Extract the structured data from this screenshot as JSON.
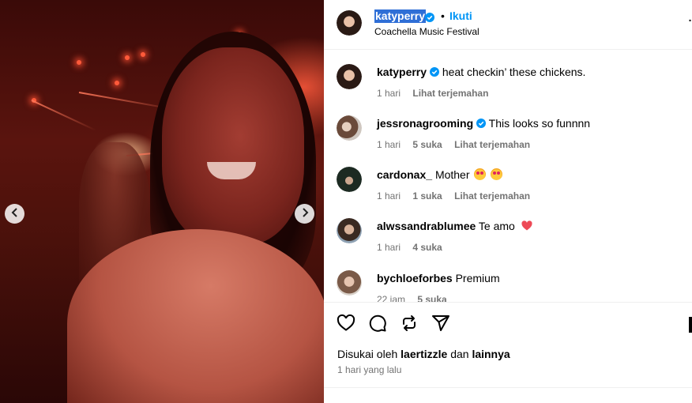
{
  "post_header": {
    "username": "katyperry",
    "separator": "•",
    "follow_label": "Ikuti",
    "location": "Coachella Music Festival",
    "more_label": "..."
  },
  "comments": [
    {
      "username": "katyperry",
      "text": "heat checkin’ these chickens.",
      "time": "1 hari",
      "likes": "",
      "translate": "Lihat terjemahan",
      "verified": true
    },
    {
      "username": "jessronagrooming",
      "text": "This looks so funnnn",
      "time": "1 hari",
      "likes": "5 suka",
      "translate": "Lihat terjemahan",
      "verified": true
    },
    {
      "username": "cardonax_",
      "text": "Mother",
      "time": "1 hari",
      "likes": "1 suka",
      "translate": "Lihat terjemahan",
      "verified": false
    },
    {
      "username": "alwssandrablumee",
      "text": "Te amo",
      "time": "1 hari",
      "likes": "4 suka",
      "translate": "",
      "verified": false
    },
    {
      "username": "bychloeforbes",
      "text": "Premium",
      "time": "22 jam",
      "likes": "5 suka",
      "translate": "",
      "verified": false
    }
  ],
  "likes": {
    "prefix": "Disukai oleh",
    "user": "laertizzle",
    "conj": "dan",
    "others": "lainnya"
  },
  "timestamp": "1 hari yang lalu",
  "icons": [
    "chevron-left-icon",
    "chevron-right-icon",
    "verified-icon",
    "heart-icon",
    "comment-icon",
    "repost-icon",
    "share-icon",
    "bookmark-icon"
  ],
  "colors": {
    "accent": "#0095f6",
    "verified": "#0095f6",
    "muted": "#737373",
    "selection": "#2f6fd6"
  }
}
